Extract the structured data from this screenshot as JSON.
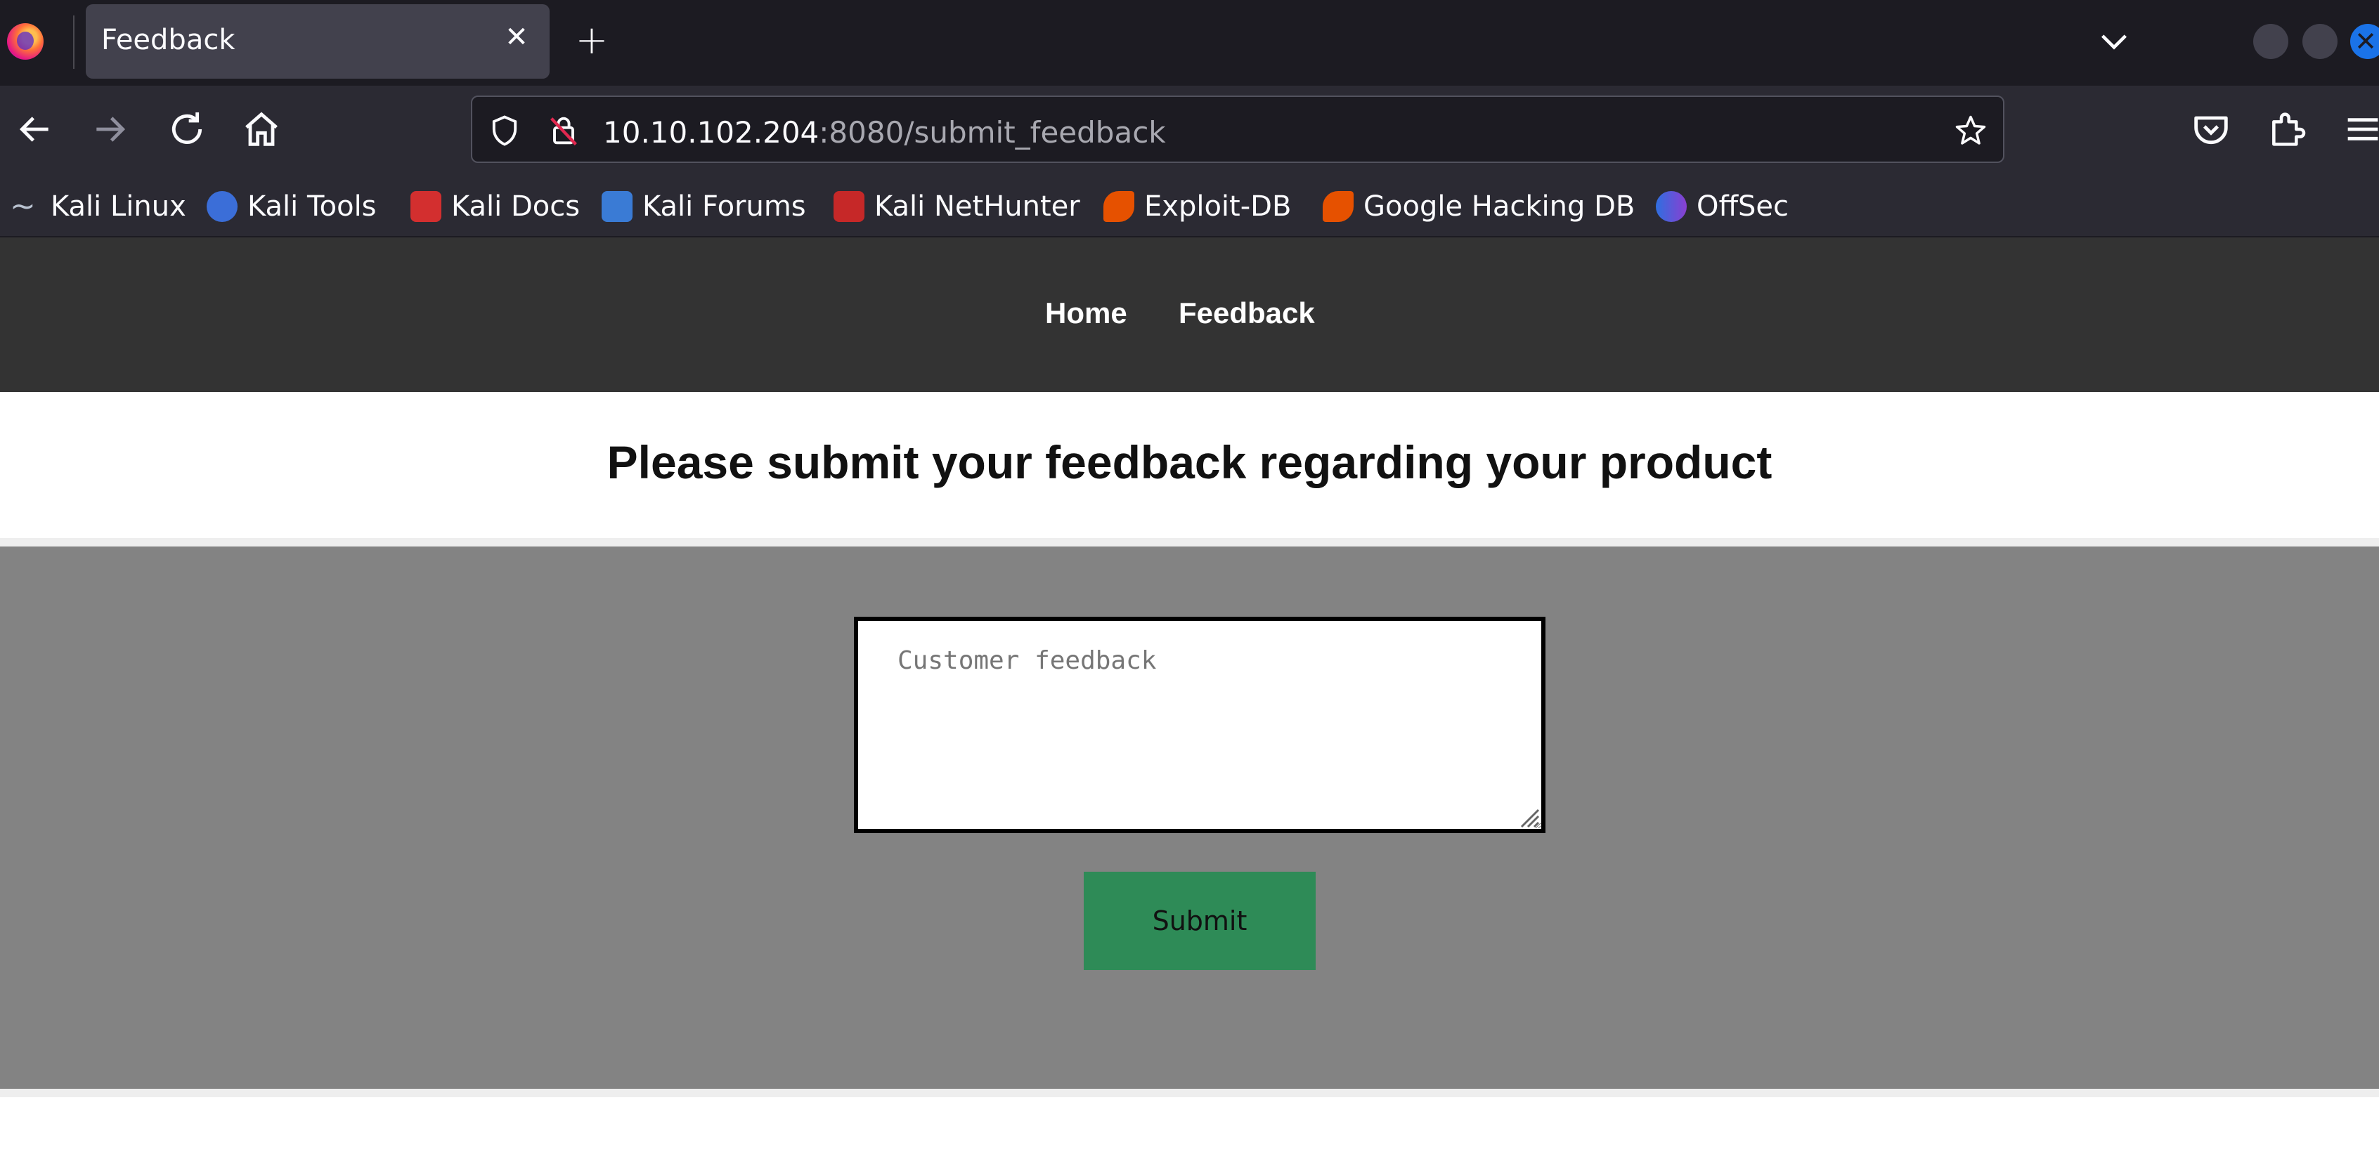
{
  "browser": {
    "tab": {
      "title": "Feedback"
    },
    "url": {
      "host": "10.10.102.204",
      "rest": ":8080/submit_feedback"
    },
    "bookmarks": [
      {
        "label": "Kali Linux",
        "icon": "kali-dragon-icon"
      },
      {
        "label": "Kali Tools",
        "icon": "kali-tools-icon"
      },
      {
        "label": "Kali Docs",
        "icon": "kali-docs-icon"
      },
      {
        "label": "Kali Forums",
        "icon": "kali-forums-icon"
      },
      {
        "label": "Kali NetHunter",
        "icon": "kali-nethunter-icon"
      },
      {
        "label": "Exploit-DB",
        "icon": "exploit-db-icon"
      },
      {
        "label": "Google Hacking DB",
        "icon": "ghdb-icon"
      },
      {
        "label": "OffSec",
        "icon": "offsec-icon"
      }
    ]
  },
  "site": {
    "nav": {
      "home": "Home",
      "feedback": "Feedback"
    },
    "heading": "Please submit your feedback regarding your product",
    "form": {
      "textarea_placeholder": "Customer feedback",
      "submit_label": "Submit"
    }
  },
  "colors": {
    "site_nav_bg": "#333333",
    "form_bg": "#838383",
    "submit_bg": "#2e8b57"
  }
}
